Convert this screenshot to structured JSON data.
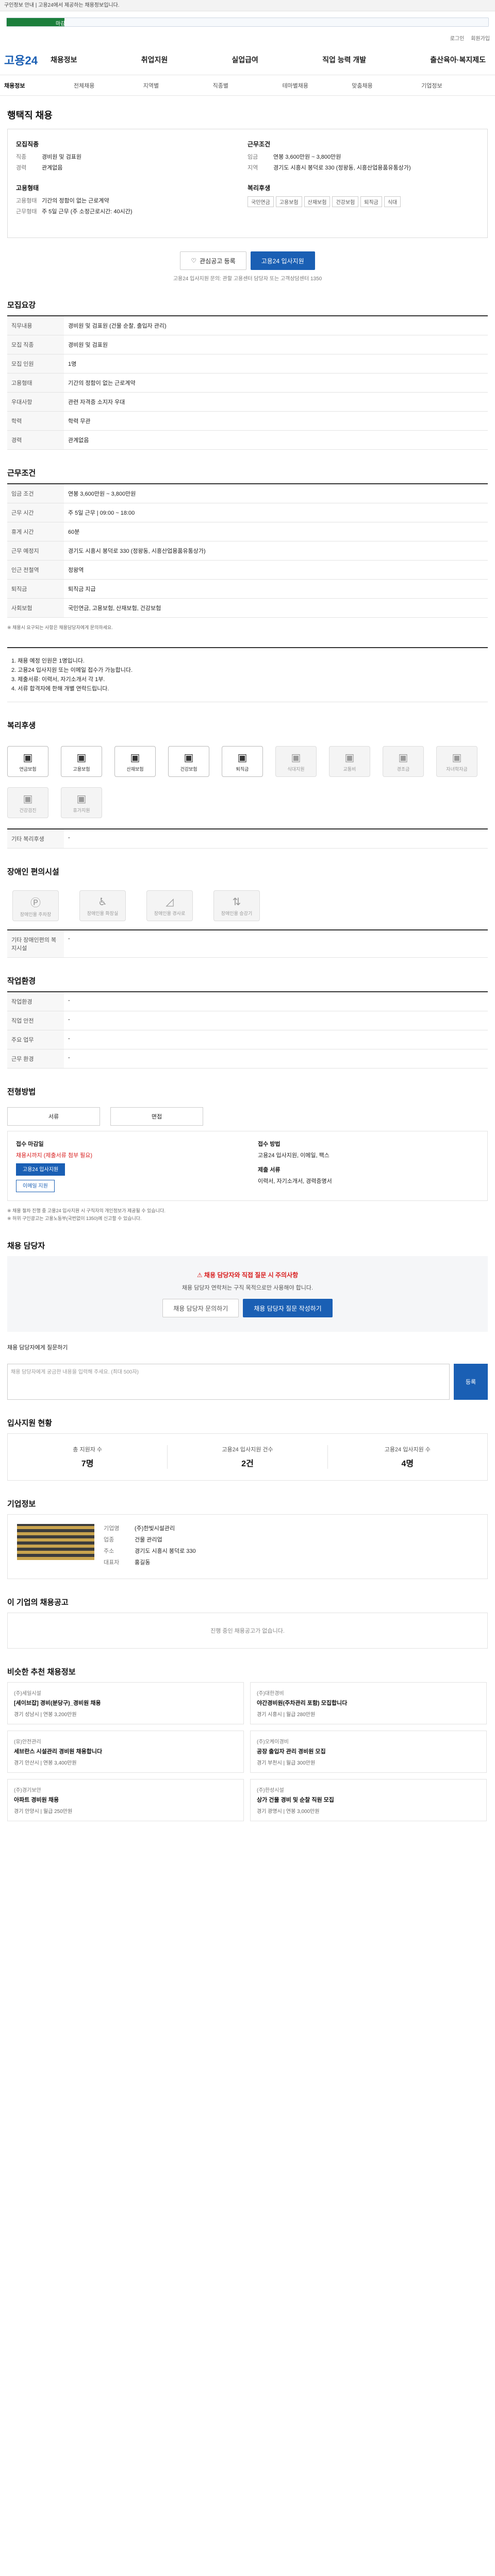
{
  "notice": "구인정보 안내 | 고용24에서 제공하는 채용정보입니다.",
  "progress": {
    "label": "마감",
    "fraction": 0.12
  },
  "util": [
    "로그인",
    "회원가입"
  ],
  "header": {
    "logo": "고용24",
    "gnb": [
      "채용정보",
      "취업지원",
      "실업급여",
      "직업 능력 개발",
      "출산육아·복지제도"
    ]
  },
  "subnav": [
    "채용정보",
    "전체채용",
    "지역별",
    "직종별",
    "테마별채용",
    "맞춤채용",
    "기업정보"
  ],
  "job": {
    "title": "행택직 채용"
  },
  "summary": {
    "left_title": "모집직종",
    "left_rows": [
      {
        "k": "직종",
        "v": "경비원 및 검표원"
      },
      {
        "k": "경력",
        "v": "관계없음"
      }
    ],
    "right_title": "근무조건",
    "right_rows": [
      {
        "k": "임금",
        "v": "연봉 3,600만원 ~ 3,800만원"
      },
      {
        "k": "지역",
        "v": "경기도 시흥시 봉덕로 330 (정왕동, 시흥산업용품유통상가)"
      }
    ],
    "left2_title": "고용형태",
    "left2_rows": [
      {
        "k": "고용형태",
        "v": "기간의 정함이 없는 근로계약"
      },
      {
        "k": "근무형태",
        "v": "주 5일 근무 (주 소정근로시간: 40시간)"
      }
    ],
    "right2_title": "복리후생",
    "right2_tags": [
      "국민연금",
      "고용보험",
      "산재보험",
      "건강보험",
      "퇴직금",
      "식대"
    ]
  },
  "actions": {
    "save": "관심공고 등록",
    "apply": "고용24 입사지원"
  },
  "help_line": "고용24 입사지원 문의: 관할 고용센터 담당자 또는 고객상담센터 1350",
  "sections": {
    "recruit": "모집요강",
    "work": "근무조건",
    "welfare": "복리후생",
    "barrier": "장애인 편의시설",
    "env": "작업환경",
    "process": "전형방법",
    "qna": "채용 담당자",
    "stats": "입사지원 현황",
    "company": "기업정보",
    "others": "이 기업의 채용공고",
    "recommend": "비슷한 추천 채용정보"
  },
  "recruit_rows": [
    {
      "k": "직무내용",
      "v": "경비원 및 검표원 (건물 순찰, 출입자 관리)"
    },
    {
      "k": "모집 직종",
      "v": "경비원 및 검표원"
    },
    {
      "k": "모집 인원",
      "v": "1명"
    },
    {
      "k": "고용형태",
      "v": "기간의 정함이 없는 근로계약"
    },
    {
      "k": "우대사항",
      "v": "관련 자격증 소지자 우대"
    },
    {
      "k": "학력",
      "v": "학력 무관"
    },
    {
      "k": "경력",
      "v": "관계없음"
    }
  ],
  "work_rows": [
    {
      "k": "임금 조건",
      "v": "연봉 3,600만원 ~ 3,800만원"
    },
    {
      "k": "근무 시간",
      "v": "주 5일 근무 | 09:00 ~ 18:00"
    },
    {
      "k": "휴게 시간",
      "v": "60분"
    },
    {
      "k": "근무 예정지",
      "v": "경기도 시흥시 봉덕로 330 (정왕동, 시흥산업용품유통상가)"
    },
    {
      "k": "인근 전철역",
      "v": "정왕역"
    },
    {
      "k": "퇴직금",
      "v": "퇴직금 지급"
    },
    {
      "k": "사회보험",
      "v": "국민연금, 고용보험, 산재보험, 건강보험"
    }
  ],
  "recruit_note": "※ 채용시 요구되는 사항은 채용담당자에게 문의하세요.",
  "job_desc": "1. 채용 예정 인원은 1명입니다.\n2. 고용24 입사지원 또는 이메일 접수가 가능합니다.\n3. 제출서류: 이력서, 자기소개서 각 1부.\n4. 서류 합격자에 한해 개별 연락드립니다.",
  "welfare_items": [
    {
      "label": "연금보험",
      "on": true
    },
    {
      "label": "고용보험",
      "on": true
    },
    {
      "label": "산재보험",
      "on": true
    },
    {
      "label": "건강보험",
      "on": true
    },
    {
      "label": "퇴직금",
      "on": true
    },
    {
      "label": "식대지원",
      "on": false
    },
    {
      "label": "교통비",
      "on": false
    },
    {
      "label": "경조금",
      "on": false
    },
    {
      "label": "자녀학자금",
      "on": false
    },
    {
      "label": "건강검진",
      "on": false
    },
    {
      "label": "휴가지원",
      "on": false
    }
  ],
  "welfare_note": "기타 복리후생",
  "barrier_items": [
    "장애인용 주차장",
    "장애인용 화장실",
    "장애인용 경사로",
    "장애인용 승강기"
  ],
  "barrier_note": "기타 장애인편의 복지시설",
  "env_rows": [
    {
      "k": "작업환경",
      "v": "-"
    },
    {
      "k": "직업 안전",
      "v": "-"
    },
    {
      "k": "주요 업무",
      "v": "-"
    },
    {
      "k": "근무 환경",
      "v": "-"
    }
  ],
  "process": {
    "methods": [
      "서류",
      "면접"
    ],
    "apply_title": "접수 마감일",
    "apply_date": "채용시까지 (제출서류 첨부 필요)",
    "apply_btn": "고용24 입사지원",
    "email_btn": "이메일 지원",
    "contact_title": "접수 방법",
    "contact_text": "고용24 입사지원, 이메일, 팩스",
    "doc_title": "제출 서류",
    "doc_text": "이력서, 자기소개서, 경력증명서"
  },
  "process_notes": "※ 채용 절차 진행 중 고용24 입사지원 시 구직자의 개인정보가 제공될 수 있습니다.\n※ 허위 구인광고는 고용노동부(국번없이 1350)에 신고할 수 있습니다.",
  "qna": {
    "head": "채용 담당자와 직접 질문 시 주의사항",
    "text": "채용 담당자 연락처는 구직 목적으로만 사용해야 합니다.",
    "btn1": "채용 담당자 문의하기",
    "btn2": "채용 담당자 질문 작성하기",
    "input_label": "채용 담당자에게 질문하기",
    "placeholder": "채용 담당자에게 궁금한 내용을 입력해 주세요. (최대 500자)",
    "submit": "등록"
  },
  "stats": [
    {
      "label": "총 지원자 수",
      "value": "7명"
    },
    {
      "label": "고용24 입사지원 건수",
      "value": "2건"
    },
    {
      "label": "고용24 입사지원 수",
      "value": "4명"
    }
  ],
  "company": {
    "rows": [
      {
        "k": "기업명",
        "v": "(주)한빛시설관리"
      },
      {
        "k": "업종",
        "v": "건물 관리업"
      },
      {
        "k": "주소",
        "v": "경기도 시흥시 봉덕로 330"
      },
      {
        "k": "대표자",
        "v": "홍길동"
      }
    ]
  },
  "others_empty": "진행 중인 채용공고가 없습니다.",
  "recommend": [
    {
      "company": "(주)세일시설",
      "title": "[세이브잡] 경비(분당구)_경비원 채용",
      "meta": "경기 성남시 | 연봉 3,200만원"
    },
    {
      "company": "(주)대한경비",
      "title": "야간경비원(주차관리 포함) 모집합니다",
      "meta": "경기 시흥시 | 월급 280만원"
    },
    {
      "company": "(유)안전관리",
      "title": "세브란스 시설관리 경비원 채용합니다",
      "meta": "경기 안산시 | 연봉 3,400만원"
    },
    {
      "company": "(주)오케이경비",
      "title": "공장 출입자 관리 경비원 모집",
      "meta": "경기 부천시 | 월급 300만원"
    },
    {
      "company": "(주)경기보안",
      "title": "아파트 경비원 채용",
      "meta": "경기 안양시 | 월급 250만원"
    },
    {
      "company": "(주)한성시설",
      "title": "상가 건물 경비 및 순찰 직원 모집",
      "meta": "경기 광명시 | 연봉 3,000만원"
    }
  ]
}
